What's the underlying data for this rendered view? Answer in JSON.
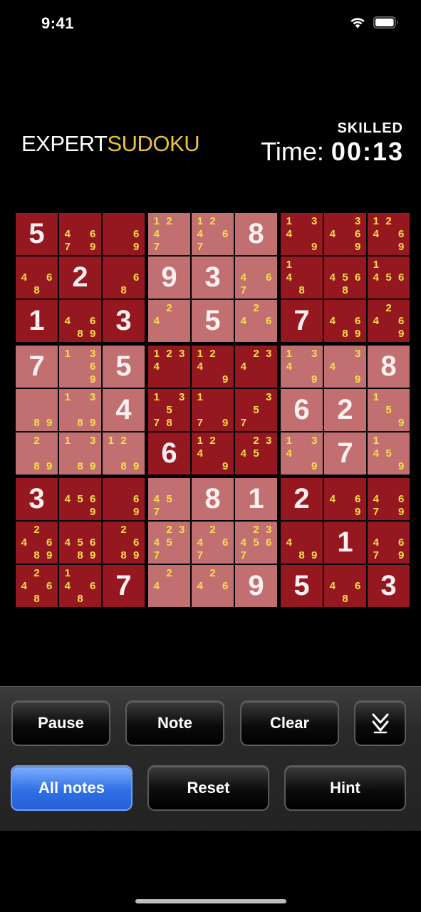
{
  "status": {
    "time": "9:41"
  },
  "logo": {
    "part1": "EXPERT",
    "part2": "SUDOKU"
  },
  "difficulty": "SKILLED",
  "timer": {
    "label": "Time:",
    "value": "00:13"
  },
  "board": {
    "rows": [
      [
        {
          "v": "5"
        },
        {
          "n": "4 6 7 9"
        },
        {
          "n": "6 9"
        },
        {
          "n": "1 2 4 7"
        },
        {
          "n": "1 2 4 6 7"
        },
        {
          "v": "8"
        },
        {
          "n": "1 3 4 9"
        },
        {
          "n": "3 4 6 9"
        },
        {
          "n": "1 2 4 6 9"
        }
      ],
      [
        {
          "n": "4 6 8"
        },
        {
          "v": "2"
        },
        {
          "n": "6 8"
        },
        {
          "v": "9"
        },
        {
          "v": "3"
        },
        {
          "n": "4 6 7"
        },
        {
          "n": "1 4 8"
        },
        {
          "n": "4 5 6 8"
        },
        {
          "n": "1 4 5 6"
        }
      ],
      [
        {
          "v": "1"
        },
        {
          "n": "4 6 8 9"
        },
        {
          "v": "3"
        },
        {
          "n": "2 4"
        },
        {
          "v": "5"
        },
        {
          "n": "2 4 6"
        },
        {
          "v": "7"
        },
        {
          "n": "4 6 8 9"
        },
        {
          "n": "2 4 6 9"
        }
      ],
      [
        {
          "v": "7"
        },
        {
          "n": "1 3 6 9"
        },
        {
          "v": "5"
        },
        {
          "n": "1 2 3 4"
        },
        {
          "n": "1 2 4 9"
        },
        {
          "n": "2 3 4"
        },
        {
          "n": "1 3 4 9"
        },
        {
          "n": "3 4 9"
        },
        {
          "v": "8"
        }
      ],
      [
        {
          "n": "8 9"
        },
        {
          "n": "1 3 8 9"
        },
        {
          "v": "4"
        },
        {
          "n": "1 3 5 7 8"
        },
        {
          "n": "1 7 9"
        },
        {
          "n": "3 5 7"
        },
        {
          "v": "6"
        },
        {
          "v": "2"
        },
        {
          "n": "1 5 9"
        }
      ],
      [
        {
          "n": "2 8 9"
        },
        {
          "n": "1 3 8 9"
        },
        {
          "n": "1 2 8 9"
        },
        {
          "v": "6"
        },
        {
          "n": "1 2 4 9"
        },
        {
          "n": "2 3 4 5"
        },
        {
          "n": "1 3 4 9"
        },
        {
          "v": "7"
        },
        {
          "n": "1 4 5 9"
        }
      ],
      [
        {
          "v": "3"
        },
        {
          "n": "4 5 6 9"
        },
        {
          "n": "6 9"
        },
        {
          "n": "4 5 7"
        },
        {
          "v": "8"
        },
        {
          "v": "1"
        },
        {
          "v": "2"
        },
        {
          "n": "4 6 9"
        },
        {
          "n": "4 6 7 9"
        }
      ],
      [
        {
          "n": "2 4 6 8 9"
        },
        {
          "n": "4 5 6 8 9"
        },
        {
          "n": "2 6 8 9"
        },
        {
          "n": "2 3 4 5 7"
        },
        {
          "n": "2 4 6 7"
        },
        {
          "n": "2 3 4 5 6 7"
        },
        {
          "n": "4 8 9"
        },
        {
          "v": "1"
        },
        {
          "n": "4 6 7 9"
        }
      ],
      [
        {
          "n": "2 4 6 8"
        },
        {
          "n": "1 4 6 8"
        },
        {
          "v": "7"
        },
        {
          "n": "2 4"
        },
        {
          "n": "2 4 6"
        },
        {
          "v": "9"
        },
        {
          "v": "5"
        },
        {
          "n": "4 6 8"
        },
        {
          "v": "3"
        }
      ]
    ]
  },
  "buttons": {
    "pause": "Pause",
    "note": "Note",
    "clear": "Clear",
    "expand_icon": "double-chevron-down",
    "all_notes": "All notes",
    "reset": "Reset",
    "hint": "Hint"
  },
  "colors": {
    "cell_dark": "#951720",
    "cell_light": "#c16f70",
    "note": "#f4e04a",
    "accent_blue": "#2f70e6",
    "logo_gold": "#ecc23a"
  }
}
